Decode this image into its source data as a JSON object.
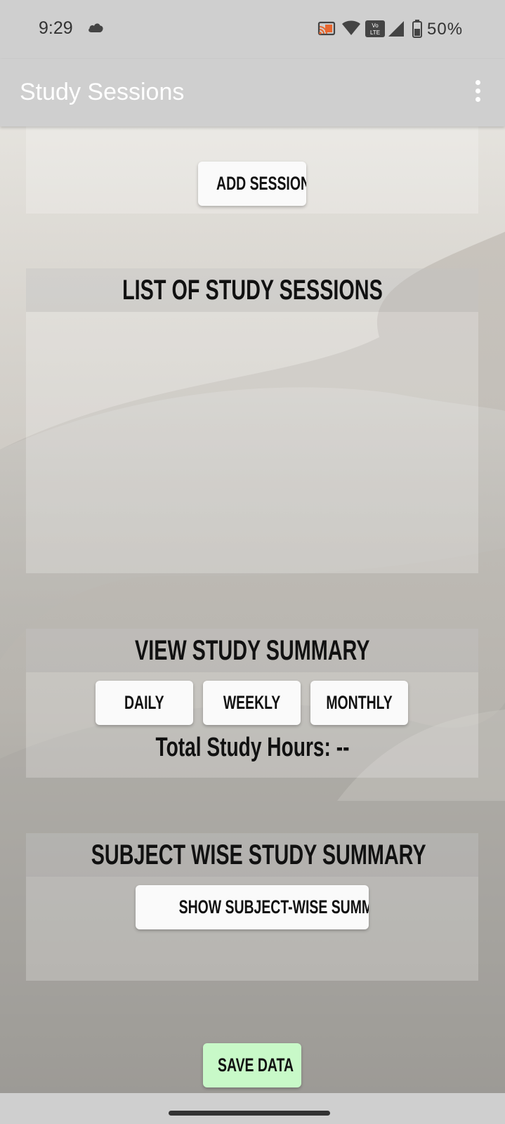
{
  "status_bar": {
    "time": "9:29",
    "battery": "50%",
    "icons": [
      "cloud-icon",
      "cast-icon",
      "wifi-icon",
      "volte-icon",
      "signal-icon",
      "battery-icon"
    ]
  },
  "app_bar": {
    "title": "Study Sessions",
    "menu_icon": "overflow-menu-icon"
  },
  "add_section": {
    "add_button_label": "ADD SESSION"
  },
  "sessions_list": {
    "title": "LIST OF STUDY SESSIONS"
  },
  "summary": {
    "title": "VIEW STUDY SUMMARY",
    "buttons": [
      "DAILY",
      "WEEKLY",
      "MONTHLY"
    ],
    "total_label": "Total Study Hours: --"
  },
  "subject_summary": {
    "title": "SUBJECT WISE STUDY SUMMARY",
    "button_label": "SHOW SUBJECT-WISE SUMMARY"
  },
  "save_button_label": "SAVE DATA",
  "colors": {
    "bar": "#cfcfcf",
    "save_button": "#c8f9c8",
    "button": "#fafafa"
  }
}
